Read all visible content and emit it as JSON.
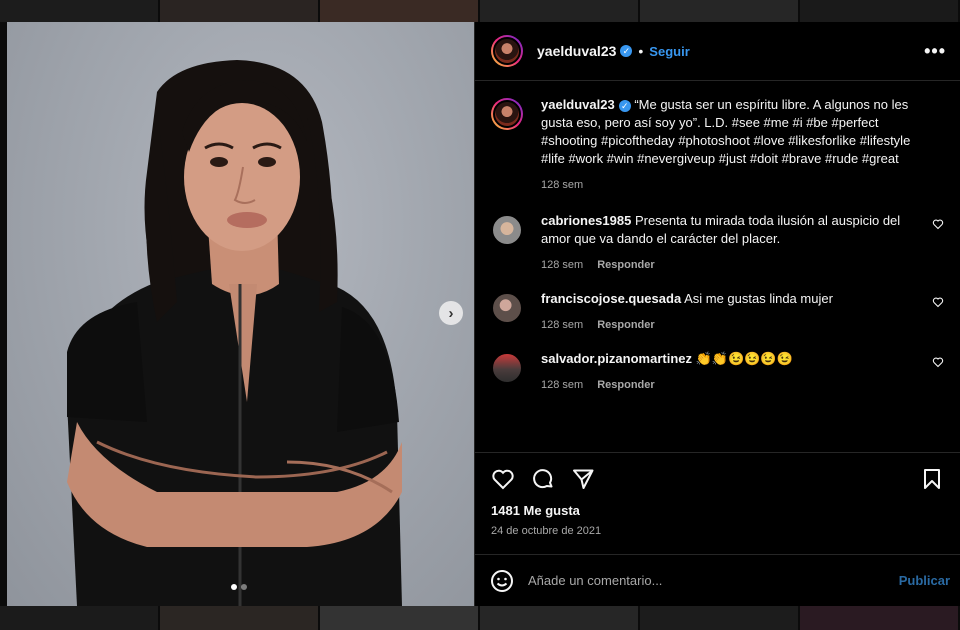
{
  "post": {
    "username": "yaelduval23",
    "follow_label": "Seguir",
    "separator": "•",
    "more_label": "•••",
    "verified_mark": "✓"
  },
  "caption": {
    "username": "yaelduval23",
    "text": " “Me gusta ser un espíritu libre. A algunos no les gusta eso, pero así soy yo”. L.D. #see #me #i #be #perfect #shooting #picoftheday #photoshoot #love #likesforlike #lifestyle #life #work #win #nevergiveup #just #doit #brave #rude #great",
    "time": "128 sem"
  },
  "comments": [
    {
      "username": "cabriones1985",
      "text": " Presenta tu mirada toda ilusión al auspicio del amor que va dando el carácter del placer.",
      "time": "128 sem",
      "reply": "Responder"
    },
    {
      "username": "franciscojose.quesada",
      "text": " Asi me gustas linda mujer",
      "time": "128 sem",
      "reply": "Responder"
    },
    {
      "username": "salvador.pizanomartinez",
      "text": " 👏👏😉😉😉😉",
      "time": "128 sem",
      "reply": "Responder"
    }
  ],
  "stats": {
    "likes": "1481 Me gusta",
    "date": "24 de octubre de 2021"
  },
  "composer": {
    "placeholder": "Añade un comentario...",
    "post_label": "Publicar"
  },
  "carousel": {
    "next_glyph": "›",
    "current_slide": 1,
    "total_slides": 2
  },
  "icons": {
    "like": "heart-icon",
    "comment": "comment-icon",
    "share": "paper-plane-icon",
    "save": "bookmark-icon",
    "emoji": "smiley-icon",
    "more": "more-options-icon"
  },
  "colors": {
    "accent": "#3897f0",
    "background": "#000000",
    "muted_text": "#a8a8a8"
  }
}
